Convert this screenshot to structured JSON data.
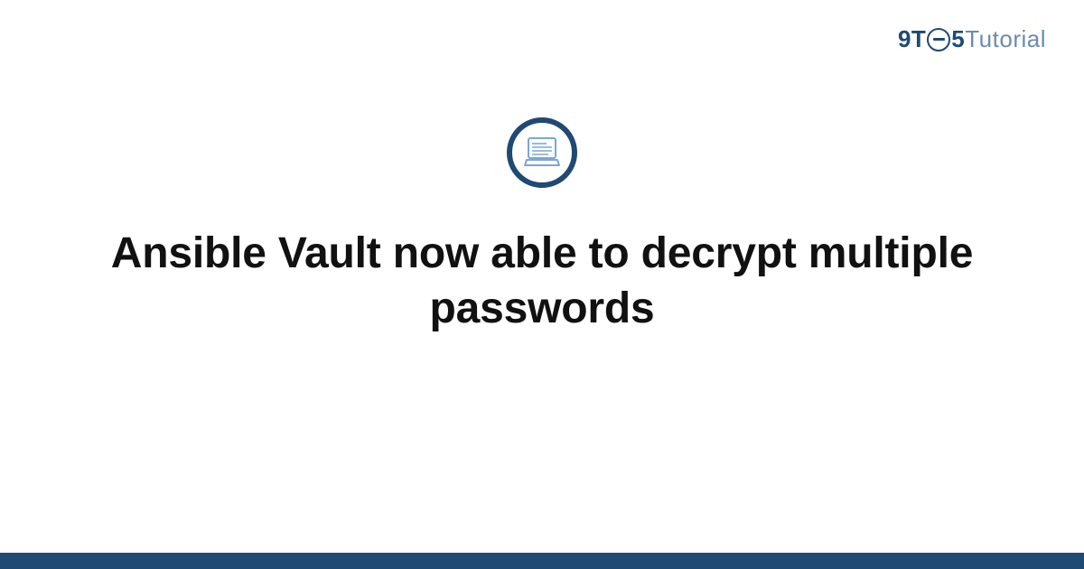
{
  "brand": {
    "part1": "9T",
    "part2": "5",
    "part3": "Tutorial"
  },
  "title": "Ansible Vault now able to decrypt multiple passwords",
  "colors": {
    "brand_dark": "#1e4a73",
    "brand_light": "#6b8caf"
  }
}
